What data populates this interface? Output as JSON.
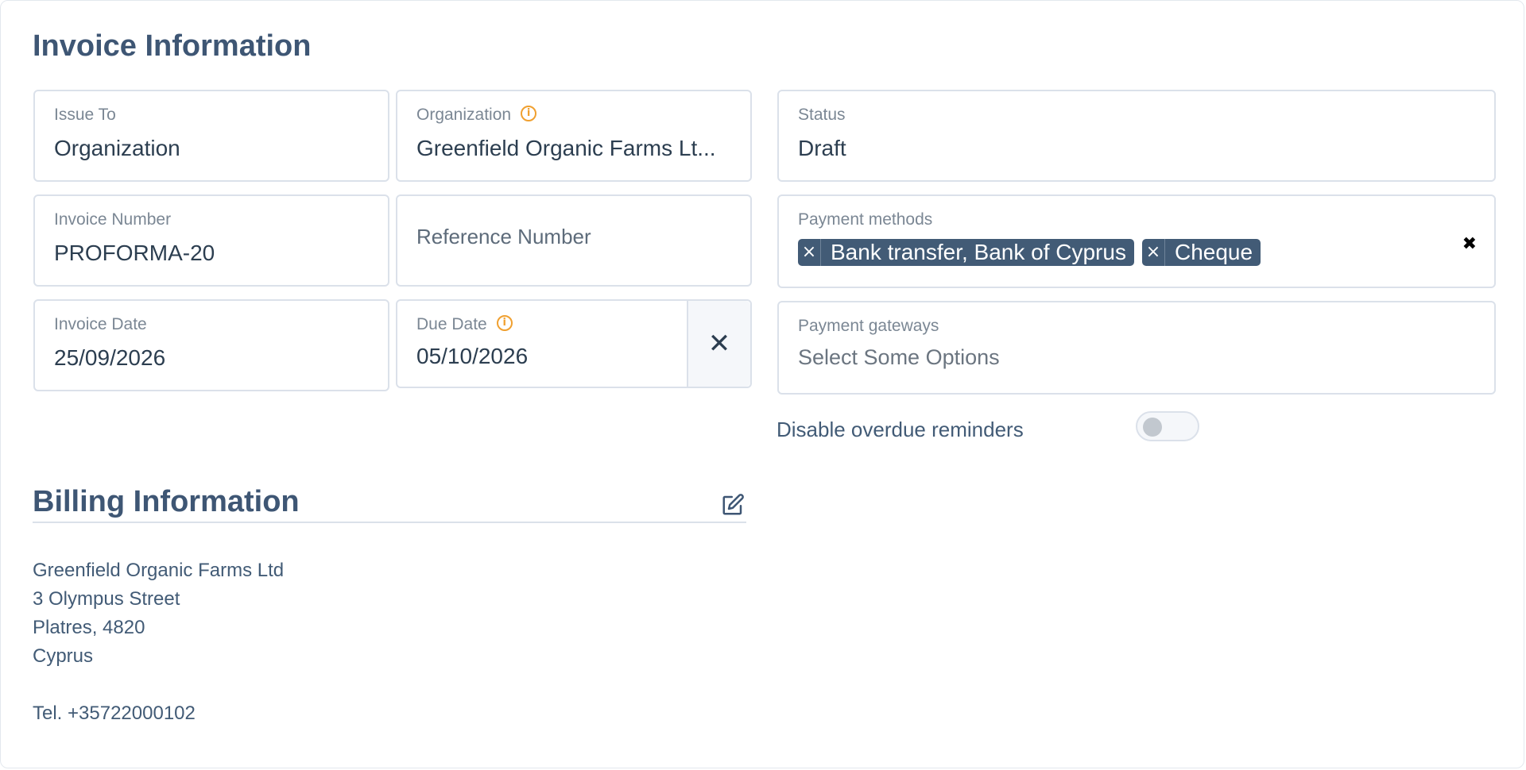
{
  "invoice": {
    "title": "Invoice Information",
    "issue_to": {
      "label": "Issue To",
      "value": "Organization"
    },
    "organization": {
      "label": "Organization",
      "value": "Greenfield Organic Farms Lt..."
    },
    "status": {
      "label": "Status",
      "value": "Draft"
    },
    "invoice_number": {
      "label": "Invoice Number",
      "value": "PROFORMA-20"
    },
    "reference_number": {
      "placeholder": "Reference Number"
    },
    "payment_methods": {
      "label": "Payment methods",
      "tags": [
        "Bank transfer, Bank of Cyprus",
        "Cheque"
      ],
      "tag_remove": "×",
      "clear_all": "✖"
    },
    "invoice_date": {
      "label": "Invoice Date",
      "value": "25/09/2026"
    },
    "due_date": {
      "label": "Due Date",
      "value": "05/10/2026",
      "clear": "✕"
    },
    "payment_gateways": {
      "label": "Payment gateways",
      "placeholder": "Select Some Options"
    },
    "overdue_toggle": {
      "label": "Disable overdue reminders",
      "checked": false
    },
    "info_icon": "i"
  },
  "billing": {
    "title": "Billing Information",
    "edit_icon": "edit-icon",
    "address_lines": [
      "Greenfield Organic Farms Ltd",
      "3 Olympus Street",
      "Platres, 4820",
      "Cyprus"
    ],
    "tel": "Tel. +35722000102"
  }
}
